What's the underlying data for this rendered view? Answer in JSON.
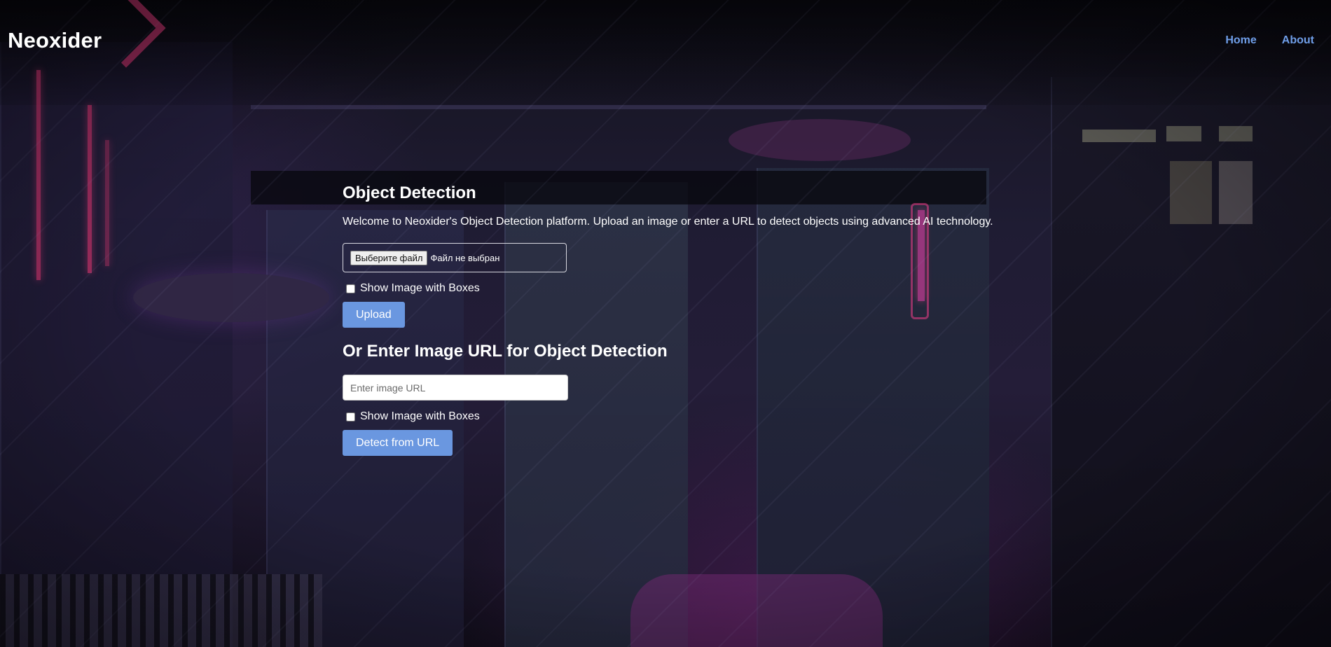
{
  "header": {
    "brand": "Neoxider",
    "nav": [
      {
        "label": "Home"
      },
      {
        "label": "About"
      }
    ]
  },
  "upload_section": {
    "title": "Object Detection",
    "intro": "Welcome to Neoxider's Object Detection platform. Upload an image or enter a URL to detect objects using advanced AI technology.",
    "file_button_label": "Выберите файл",
    "file_status": "Файл не выбран",
    "checkbox_label": "Show Image with Boxes",
    "checkbox_checked": false,
    "submit_label": "Upload"
  },
  "url_section": {
    "title": "Or Enter Image URL for Object Detection",
    "input_placeholder": "Enter image URL",
    "input_value": "",
    "checkbox_label": "Show Image with Boxes",
    "checkbox_checked": false,
    "submit_label": "Detect from URL"
  },
  "colors": {
    "link": "#6f9ee8",
    "button": "#6a97e0",
    "text": "#ffffff",
    "neon_accent": "#c0336b"
  }
}
